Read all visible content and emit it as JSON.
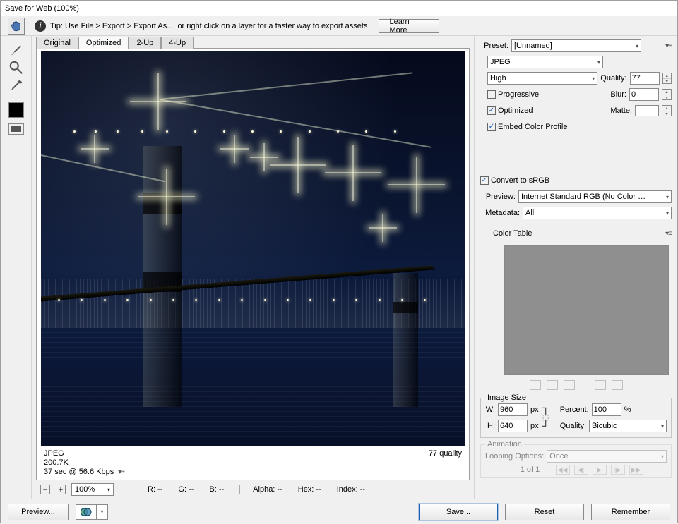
{
  "window": {
    "title": "Save for Web (100%)"
  },
  "tip": {
    "text_a": "Tip: Use File > Export > Export As...",
    "text_b": "or right click on a layer for a faster way to export assets",
    "learn_more": "Learn More"
  },
  "tabs": {
    "original": "Original",
    "optimized": "Optimized",
    "two_up": "2-Up",
    "four_up": "4-Up"
  },
  "preview_info": {
    "format": "JPEG",
    "size": "200.7K",
    "time": "37 sec @ 56.6 Kbps",
    "quality": "77 quality"
  },
  "zoom": {
    "value": "100%"
  },
  "readouts": {
    "r": "R: --",
    "g": "G: --",
    "b": "B: --",
    "alpha": "Alpha: --",
    "hex": "Hex: --",
    "index": "Index: --"
  },
  "preset": {
    "label": "Preset:",
    "value": "[Unnamed]",
    "format": "JPEG",
    "quality_preset": "High",
    "quality_label": "Quality:",
    "quality_value": "77",
    "progressive": "Progressive",
    "blur_label": "Blur:",
    "blur_value": "0",
    "optimized": "Optimized",
    "matte_label": "Matte:",
    "embed": "Embed Color Profile",
    "convert": "Convert to sRGB",
    "preview_label": "Preview:",
    "preview_value": "Internet Standard RGB (No Color Manag...",
    "metadata_label": "Metadata:",
    "metadata_value": "All"
  },
  "colortable": {
    "title": "Color Table"
  },
  "imagesize": {
    "title": "Image Size",
    "w_label": "W:",
    "w_value": "960",
    "w_unit": "px",
    "h_label": "H:",
    "h_value": "640",
    "h_unit": "px",
    "percent_label": "Percent:",
    "percent_value": "100",
    "percent_unit": "%",
    "quality_label": "Quality:",
    "quality_value": "Bicubic"
  },
  "animation": {
    "title": "Animation",
    "looping_label": "Looping Options:",
    "looping_value": "Once",
    "frame": "1 of 1"
  },
  "footer": {
    "preview": "Preview...",
    "save": "Save...",
    "reset": "Reset",
    "remember": "Remember"
  }
}
